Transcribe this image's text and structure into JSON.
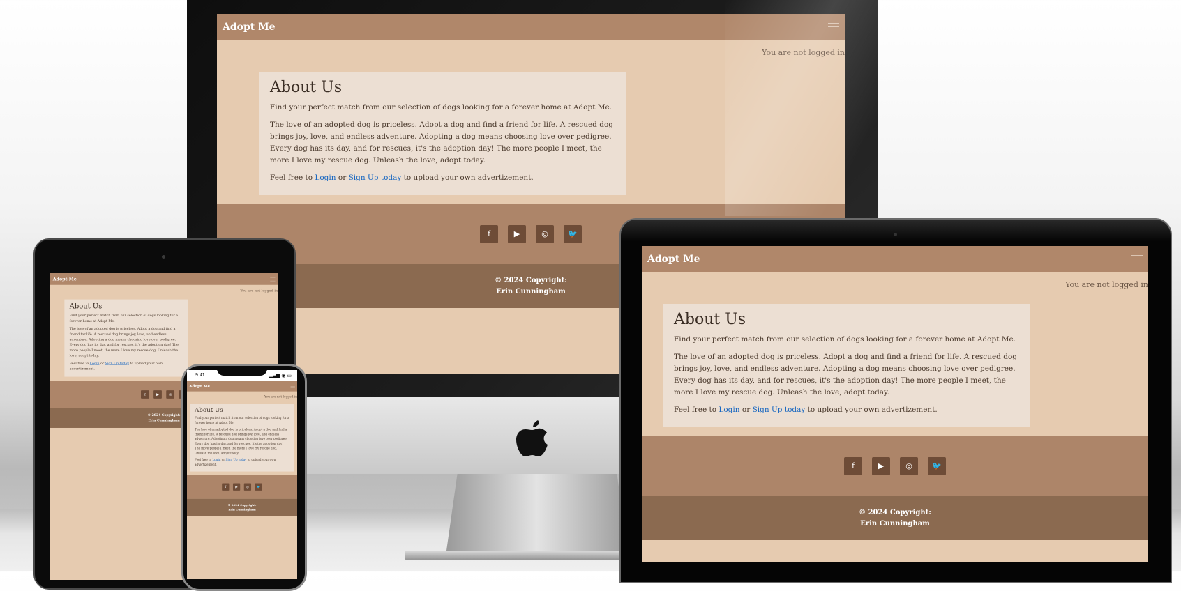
{
  "brand": "Adopt Me",
  "login_status": "You are not logged in",
  "about": {
    "title": "About Us",
    "intro": "Find your perfect match from our selection of dogs looking for a forever home at Adopt Me.",
    "body": "The love of an adopted dog is priceless. Adopt a dog and find a friend for life. A rescued dog brings joy, love, and endless adventure. Adopting a dog means choosing love over pedigree. Every dog has its day, and for rescues, it's the adoption day! The more people I meet, the more I love my rescue dog. Unleash the love, adopt today.",
    "cta_prefix": "Feel free to ",
    "login_link": "Login",
    "cta_or": " or ",
    "signup_link": "Sign Up today",
    "cta_suffix": " to upload your own advertizement."
  },
  "social": [
    {
      "name": "facebook",
      "glyph": "f"
    },
    {
      "name": "youtube",
      "glyph": "▶"
    },
    {
      "name": "instagram",
      "glyph": "◎"
    },
    {
      "name": "twitter",
      "glyph": "🐦"
    }
  ],
  "footer": {
    "line1": "© 2024 Copyright:",
    "line2": "Erin Cunningham"
  },
  "phone_status": {
    "time": "9:41",
    "icons": "▂▄▆ ◉ ▭"
  },
  "colors": {
    "nav": "#b0876a",
    "page_bg": "#e6cbb0",
    "card_bg": "#ecdfd3",
    "social_bar": "#ad8569",
    "footer": "#8b6a50",
    "link": "#1565c0"
  }
}
